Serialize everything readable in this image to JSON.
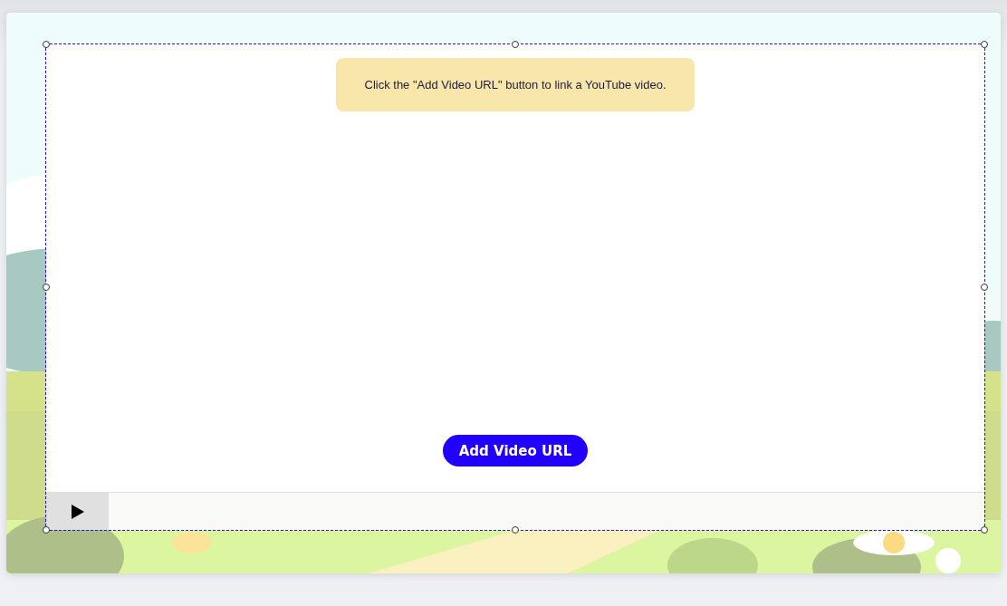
{
  "video_block": {
    "selected": true,
    "notice": "Click the \"Add Video URL\" button to link a YouTube video.",
    "add_button": "Add Video URL",
    "player": {
      "playing": false
    }
  }
}
